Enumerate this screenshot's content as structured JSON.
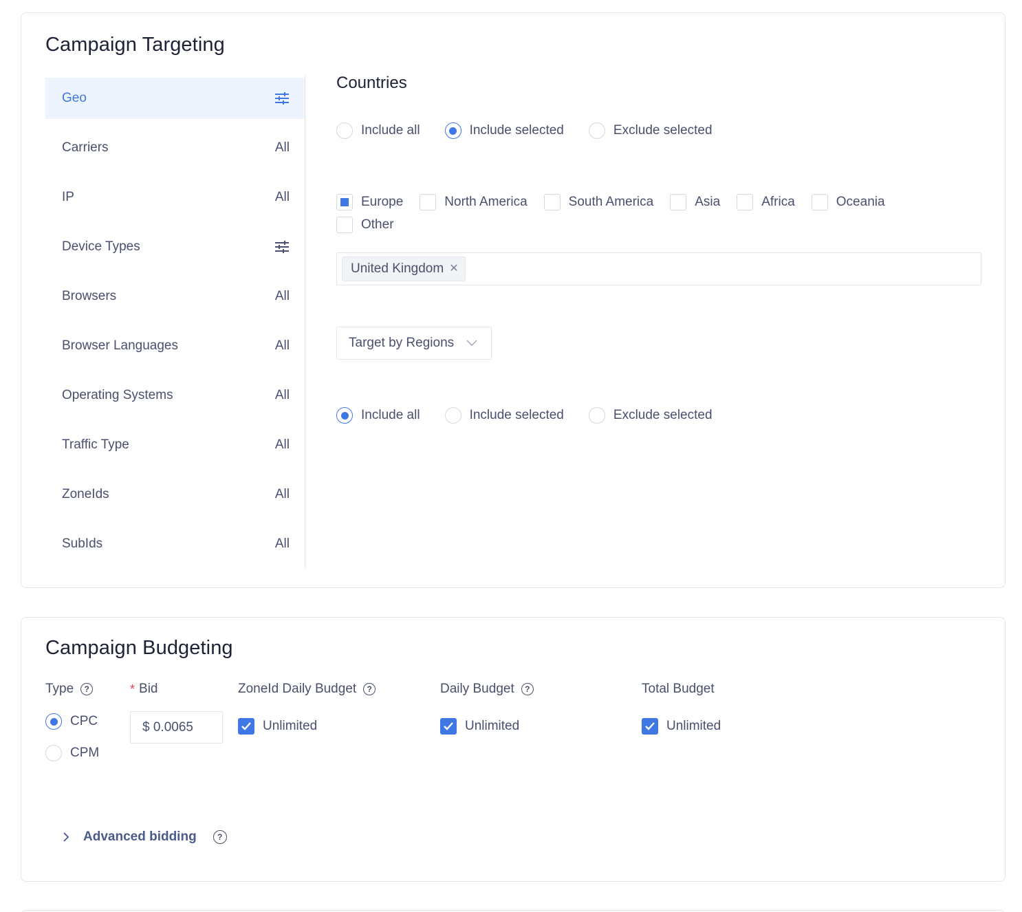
{
  "targeting": {
    "title": "Campaign Targeting",
    "sidebar": [
      {
        "label": "Geo",
        "value": "",
        "icon": "filter-icon",
        "active": true
      },
      {
        "label": "Carriers",
        "value": "All"
      },
      {
        "label": "IP",
        "value": "All"
      },
      {
        "label": "Device Types",
        "value": "",
        "icon": "filter-icon"
      },
      {
        "label": "Browsers",
        "value": "All"
      },
      {
        "label": "Browser Languages",
        "value": "All"
      },
      {
        "label": "Operating Systems",
        "value": "All"
      },
      {
        "label": "Traffic Type",
        "value": "All"
      },
      {
        "label": "ZoneIds",
        "value": "All"
      },
      {
        "label": "SubIds",
        "value": "All"
      }
    ],
    "countries": {
      "title": "Countries",
      "mode_options": [
        "Include all",
        "Include selected",
        "Exclude selected"
      ],
      "mode_selected": "Include selected",
      "continents": [
        {
          "label": "Europe",
          "state": "partial"
        },
        {
          "label": "North America",
          "state": "unchecked"
        },
        {
          "label": "South America",
          "state": "unchecked"
        },
        {
          "label": "Asia",
          "state": "unchecked"
        },
        {
          "label": "Africa",
          "state": "unchecked"
        },
        {
          "label": "Oceania",
          "state": "unchecked"
        },
        {
          "label": "Other",
          "state": "unchecked"
        }
      ],
      "selected_tags": [
        "United Kingdom"
      ]
    },
    "regions": {
      "select_label": "Target by Regions",
      "mode_options": [
        "Include all",
        "Include selected",
        "Exclude selected"
      ],
      "mode_selected": "Include all"
    }
  },
  "budgeting": {
    "title": "Campaign Budgeting",
    "type_label": "Type",
    "type_options": [
      "CPC",
      "CPM"
    ],
    "type_selected": "CPC",
    "bid_label": "Bid",
    "bid_required_mark": "*",
    "bid_value": "$ 0.0065",
    "zoneid_daily_label": "ZoneId Daily Budget",
    "daily_label": "Daily Budget",
    "total_label": "Total Budget",
    "unlimited_label": "Unlimited",
    "advanced_label": "Advanced bidding",
    "help_glyph": "?"
  },
  "colors": {
    "accent": "#3f77e4",
    "active_bg": "#eef4fd",
    "text": "#4a4f6e",
    "heading": "#1e2235",
    "border": "#e3e6ee",
    "required": "#e0424b"
  }
}
